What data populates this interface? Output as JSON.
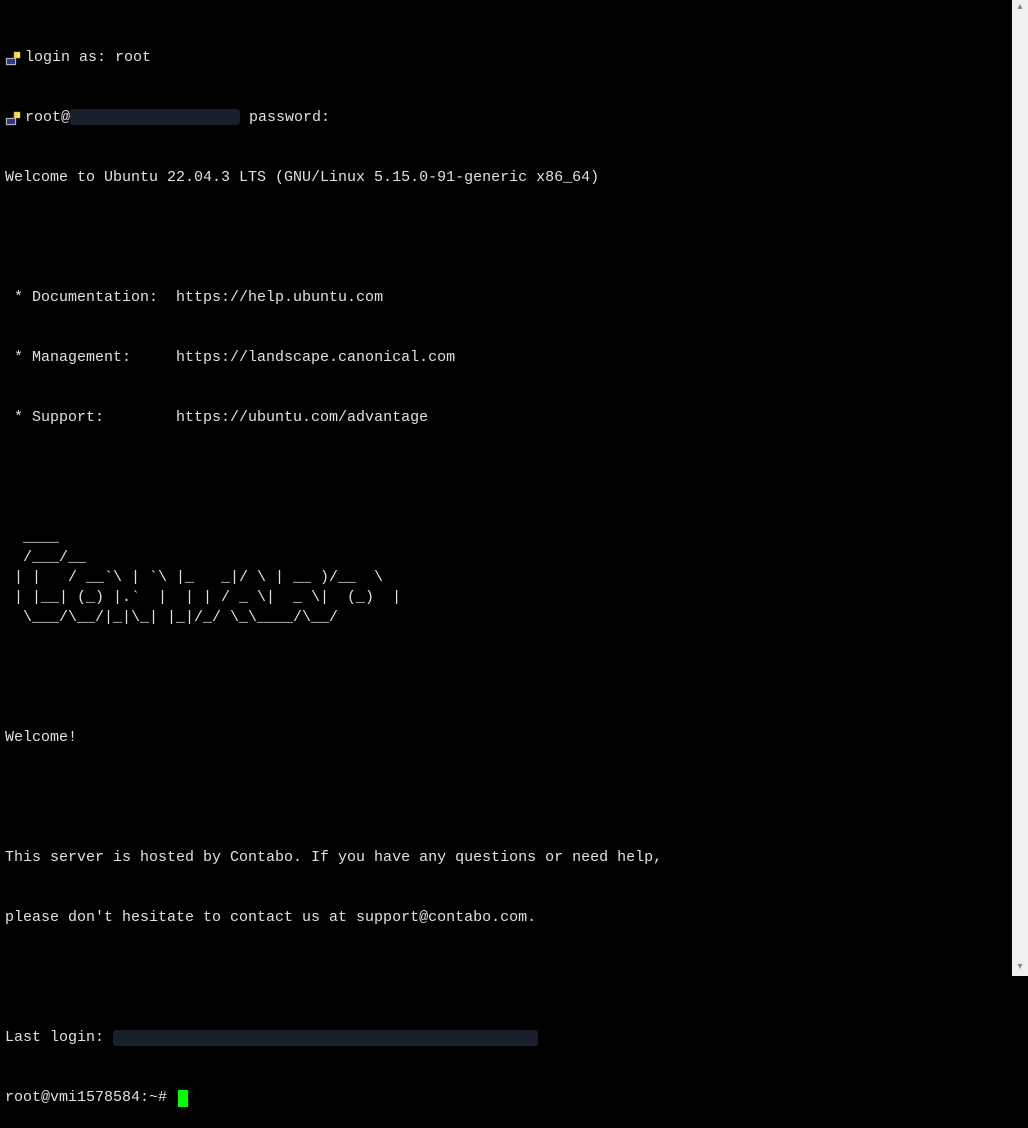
{
  "login": {
    "prompt": "login as:",
    "user": "root",
    "password_prompt_prefix": "root@",
    "password_prompt_suffix": " password:"
  },
  "motd": {
    "welcome_line": "Welcome to Ubuntu 22.04.3 LTS (GNU/Linux 5.15.0-91-generic x86_64)",
    "doc_label": " * Documentation:  ",
    "doc_url": "https://help.ubuntu.com",
    "mgmt_label": " * Management:     ",
    "mgmt_url": "https://landscape.canonical.com",
    "support_label": " * Support:        ",
    "support_url": "https://ubuntu.com/advantage",
    "ascii_art": "  ____\n  /___/__  \n | |   / __`\\ | `\\ |_   _|/ \\ | __ )/__  \\\n | |__| (_) |.`  |  | | / _ \\|  _ \\|  (_)  |\n  \\___/\\__/|_|\\_| |_|/_/ \\_\\____/\\__/",
    "welcome": "Welcome!",
    "host_msg_1": "This server is hosted by Contabo. If you have any questions or need help,",
    "host_msg_2": "please don't hesitate to contact us at support@contabo.com.",
    "last_login_label": "Last login: "
  },
  "prompt": {
    "text": "root@vmi1578584:~# "
  }
}
